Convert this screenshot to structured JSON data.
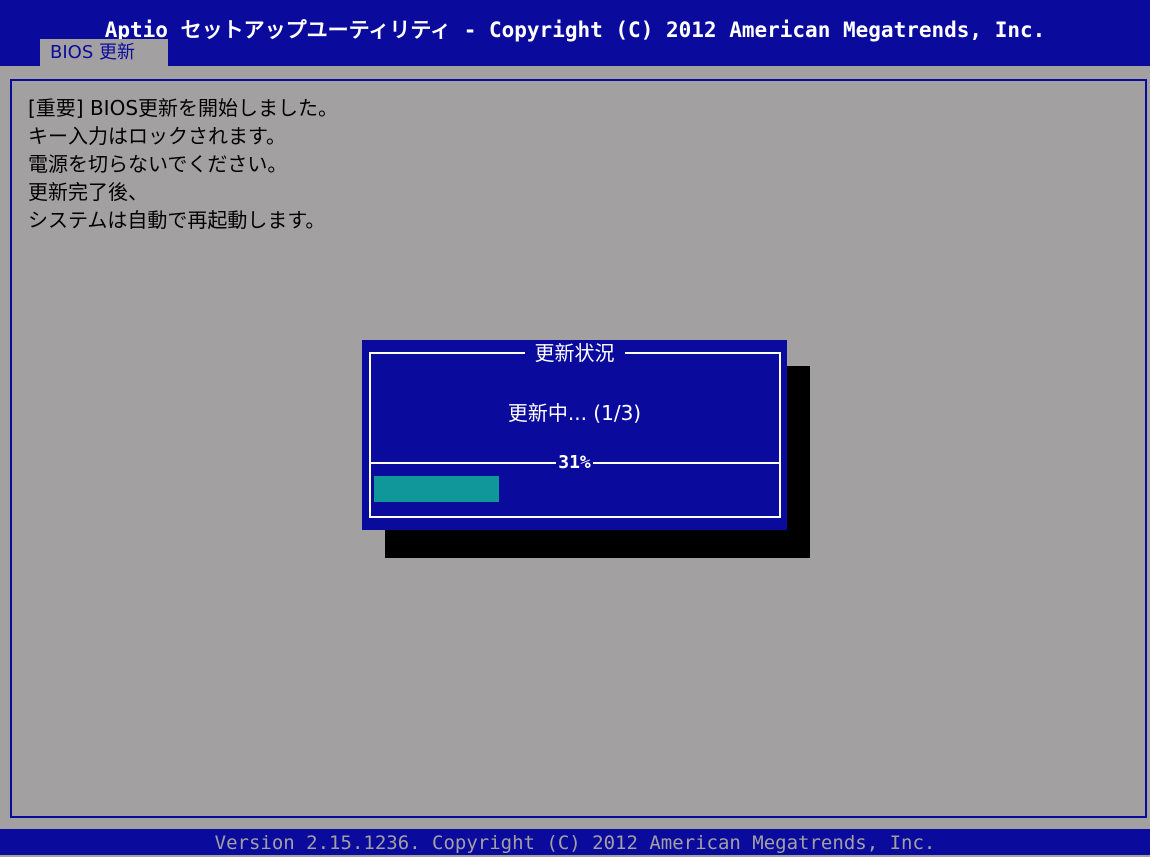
{
  "header": {
    "title": "Aptio セットアップユーティリティ - Copyright (C) 2012 American Megatrends, Inc.",
    "active_tab": "BIOS 更新"
  },
  "main": {
    "message_lines": [
      "[重要] BIOS更新を開始しました。",
      "キー入力はロックされます。",
      "電源を切らないでください。",
      "更新完了後、",
      "システムは自動で再起動します。"
    ]
  },
  "dialog": {
    "title": "更新状況",
    "status_text": "更新中... (1/3)",
    "progress_label": "31%",
    "progress_fraction": 0.31
  },
  "footer": {
    "version_text": "Version 2.15.1236. Copyright (C) 2012 American Megatrends, Inc."
  },
  "colors": {
    "background": "#a3a0a2",
    "bar_blue": "#0a0a9c",
    "progress_fill": "#10979a",
    "shadow": "#000000",
    "text_white": "#ffffff"
  }
}
